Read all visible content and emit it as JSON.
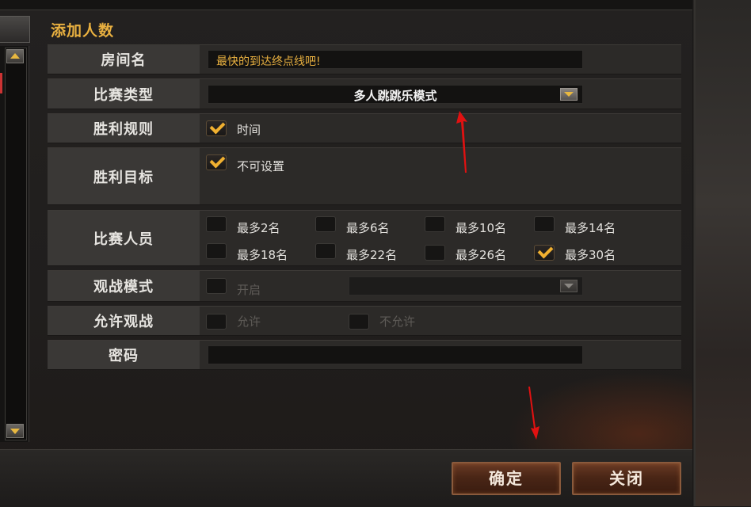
{
  "section_title": "添加人数",
  "rows": {
    "room_name": {
      "label": "房间名",
      "value": "最快的到达终点线吧!"
    },
    "match_type": {
      "label": "比赛类型",
      "value": "多人跳跳乐模式"
    },
    "win_rule": {
      "label": "胜利规则",
      "option": "时间",
      "checked": true
    },
    "win_target": {
      "label": "胜利目标",
      "option": "不可设置",
      "checked": true
    },
    "players": {
      "label": "比赛人员",
      "options": [
        {
          "text": "最多2名",
          "checked": false
        },
        {
          "text": "最多6名",
          "checked": false
        },
        {
          "text": "最多10名",
          "checked": false
        },
        {
          "text": "最多14名",
          "checked": false
        },
        {
          "text": "最多18名",
          "checked": false
        },
        {
          "text": "最多22名",
          "checked": false
        },
        {
          "text": "最多26名",
          "checked": false
        },
        {
          "text": "最多30名",
          "checked": true
        }
      ]
    },
    "spectate_mode": {
      "label": "观战模式",
      "option": "开启",
      "checked": false,
      "select_value": ""
    },
    "allow_spectate": {
      "label": "允许观战",
      "allow": "允许",
      "disallow": "不允许"
    },
    "password": {
      "label": "密码",
      "value": ""
    }
  },
  "buttons": {
    "confirm": "确定",
    "close": "关闭"
  },
  "colors": {
    "accent": "#e8b040",
    "annotation_arrow": "#e11111"
  }
}
